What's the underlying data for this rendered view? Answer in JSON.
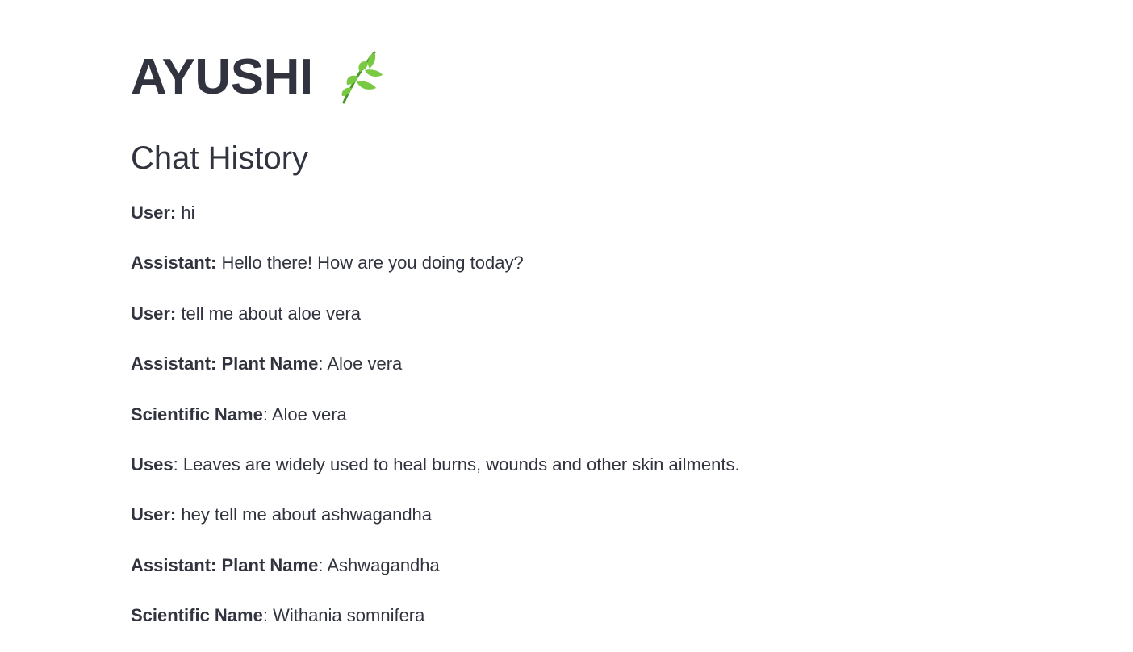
{
  "app": {
    "title": "AYUSHI",
    "icon": "herb-leaf-icon",
    "icon_color": "#7ac943"
  },
  "history": {
    "heading": "Chat History",
    "messages": [
      {
        "role": "User:",
        "sublabel": "",
        "text": " hi"
      },
      {
        "role": "Assistant:",
        "sublabel": "",
        "text": " Hello there! How are you doing today?"
      },
      {
        "role": "User:",
        "sublabel": "",
        "text": " tell me about aloe vera"
      },
      {
        "role": "Assistant: ",
        "sublabel": "Plant Name",
        "text": ": Aloe vera"
      },
      {
        "role": "",
        "sublabel": "Scientific Name",
        "text": ": Aloe vera"
      },
      {
        "role": "",
        "sublabel": "Uses",
        "text": ": Leaves are widely used to heal burns, wounds and other skin ailments."
      },
      {
        "role": "User:",
        "sublabel": "",
        "text": " hey tell me about ashwagandha"
      },
      {
        "role": "Assistant: ",
        "sublabel": "Plant Name",
        "text": ": Ashwagandha"
      },
      {
        "role": "",
        "sublabel": "Scientific Name",
        "text": ": Withania somnifera"
      }
    ]
  },
  "colors": {
    "text": "#31333f",
    "background": "#ffffff"
  }
}
